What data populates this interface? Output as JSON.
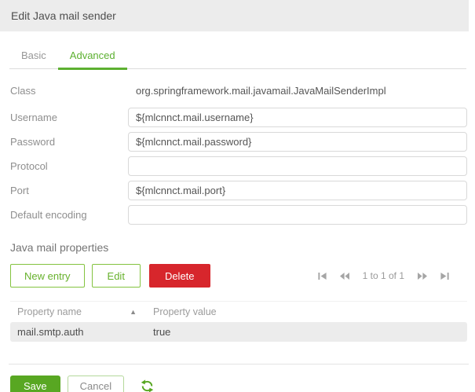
{
  "dialog": {
    "title": "Edit Java mail sender"
  },
  "tabs": [
    {
      "label": "Basic",
      "active": false
    },
    {
      "label": "Advanced",
      "active": true
    }
  ],
  "form": {
    "fields": [
      {
        "label": "Class",
        "type": "static",
        "value": "org.springframework.mail.javamail.JavaMailSenderImpl"
      },
      {
        "label": "Username",
        "type": "input",
        "value": "${mlcnnct.mail.username}"
      },
      {
        "label": "Password",
        "type": "input",
        "value": "${mlcnnct.mail.password}"
      },
      {
        "label": "Protocol",
        "type": "input",
        "value": ""
      },
      {
        "label": "Port",
        "type": "input",
        "value": "${mlcnnct.mail.port}"
      },
      {
        "label": "Default encoding",
        "type": "input",
        "value": ""
      }
    ]
  },
  "properties": {
    "heading": "Java mail properties",
    "toolbar": {
      "new_entry": "New entry",
      "edit": "Edit",
      "delete": "Delete"
    },
    "pagination": {
      "status": "1 to 1 of 1"
    },
    "table": {
      "columns": [
        "Property name",
        "Property value"
      ],
      "rows": [
        {
          "name": "mail.smtp.auth",
          "value": "true"
        }
      ]
    }
  },
  "footer": {
    "save": "Save",
    "cancel": "Cancel"
  },
  "icons": {
    "sort_ascending": "▲"
  },
  "colors": {
    "accent_green": "#58a722",
    "tab_green": "#5cb030",
    "outline_green": "#84c340",
    "delete_red": "#d7262c",
    "titlebar_bg": "#ececec",
    "row_bg": "#ececec"
  }
}
